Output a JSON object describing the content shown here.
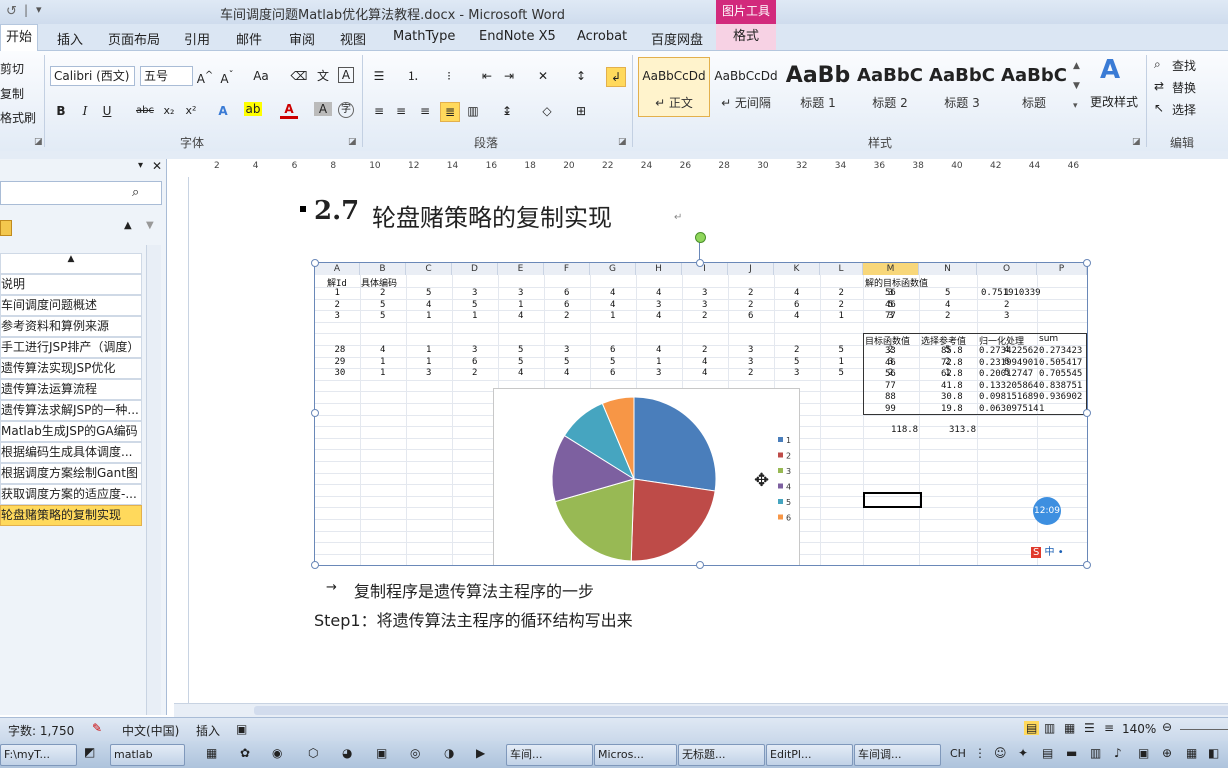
{
  "window": {
    "title": "车间调度问题Matlab优化算法教程.docx - Microsoft Word",
    "context_tools": "图片工具"
  },
  "tabs": [
    "开始",
    "插入",
    "页面布局",
    "引用",
    "邮件",
    "审阅",
    "视图",
    "MathType",
    "EndNote X5",
    "Acrobat",
    "百度网盘"
  ],
  "context_tab": "格式",
  "ribbon": {
    "clipboard": {
      "cut": "剪切",
      "copy": "复制",
      "format_painter": "格式刷"
    },
    "font": {
      "name": "Calibri (西文)",
      "size": "五号",
      "label": "字体"
    },
    "paragraph": {
      "label": "段落"
    },
    "styles": {
      "label": "样式",
      "items": [
        {
          "preview": "AaBbCcDd",
          "name": "↵ 正文"
        },
        {
          "preview": "AaBbCcDd",
          "name": "↵ 无间隔"
        },
        {
          "preview": "AaBb",
          "name": "标题 1"
        },
        {
          "preview": "AaBbC",
          "name": "标题 2"
        },
        {
          "preview": "AaBbC",
          "name": "标题 3"
        },
        {
          "preview": "AaBbC",
          "name": "标题"
        }
      ],
      "change_styles": "更改样式"
    },
    "editing": {
      "label": "编辑",
      "find": "查找",
      "replace": "替换",
      "select": "选择"
    }
  },
  "ruler": {
    "marks": [
      "2",
      "4",
      "6",
      "8",
      "10",
      "12",
      "14",
      "16",
      "18",
      "20",
      "22",
      "24",
      "26",
      "28",
      "30",
      "32",
      "34",
      "36",
      "38",
      "40",
      "42",
      "44",
      "46"
    ]
  },
  "nav": {
    "items": [
      "说明",
      "车间调度问题概述",
      "参考资料和算例来源",
      "手工进行JSP排产（调度）",
      "遗传算法实现JSP优化",
      "遗传算法运算流程",
      "遗传算法求解JSP的一种...",
      "Matlab生成JSP的GA编码",
      "根据编码生成具体调度...",
      "根据调度方案绘制Gant图",
      "获取调度方案的适应度-...",
      "轮盘赌策略的复制实现"
    ],
    "active_index": 11
  },
  "doc": {
    "heading_num": "2.7",
    "heading_text": "轮盘赌策略的复制实现",
    "para1": "复制程序是遗传算法主程序的一步",
    "para2": "Step1：将遗传算法主程序的循环结构写出来"
  },
  "sheet": {
    "columns": [
      "A",
      "B",
      "C",
      "D",
      "E",
      "F",
      "G",
      "H",
      "I",
      "J",
      "K",
      "L",
      "M",
      "N",
      "O",
      "P"
    ],
    "headers": {
      "A": "解Id",
      "B": "具体编码",
      "M": "解的目标函数值"
    },
    "rows": [
      [
        "1",
        "2",
        "5",
        "3",
        "3",
        "6",
        "4",
        "4",
        "3",
        "2",
        "4",
        "2",
        "3",
        "5",
        "1"
      ],
      [
        "2",
        "5",
        "4",
        "5",
        "1",
        "6",
        "4",
        "3",
        "3",
        "2",
        "6",
        "2",
        "5",
        "4",
        "2"
      ],
      [
        "3",
        "5",
        "1",
        "1",
        "4",
        "2",
        "1",
        "4",
        "2",
        "6",
        "4",
        "1",
        "3",
        "2",
        "3"
      ],
      [
        "28",
        "4",
        "1",
        "3",
        "5",
        "3",
        "6",
        "4",
        "2",
        "3",
        "2",
        "5",
        "2",
        "5",
        "4"
      ],
      [
        "29",
        "1",
        "1",
        "6",
        "5",
        "5",
        "5",
        "1",
        "4",
        "3",
        "5",
        "1",
        "3",
        "2",
        "6"
      ],
      [
        "30",
        "1",
        "3",
        "2",
        "4",
        "4",
        "6",
        "3",
        "4",
        "2",
        "3",
        "5",
        "2",
        "1",
        "5"
      ]
    ],
    "m_values": [
      "56",
      "46",
      "77"
    ],
    "o_value": "0.751910339",
    "table_headers": [
      "目标函数值",
      "选择参考值",
      "归一化处理",
      "sum"
    ],
    "table_rows": [
      [
        "33",
        "85.8",
        "0.273422562",
        "0.273423"
      ],
      [
        "46",
        "72.8",
        "0.231994901",
        "0.505417"
      ],
      [
        "56",
        "62.8",
        "0.20012747",
        "0.705545"
      ],
      [
        "77",
        "41.8",
        "0.133205864",
        "0.838751"
      ],
      [
        "88",
        "30.8",
        "0.098151689",
        "0.936902"
      ],
      [
        "99",
        "19.8",
        "0.063097514",
        "1"
      ]
    ],
    "totals": [
      "118.8",
      "313.8"
    ],
    "clock_badge": "12:09"
  },
  "chart_data": {
    "type": "pie",
    "categories": [
      "1",
      "2",
      "3",
      "4",
      "5",
      "6"
    ],
    "values": [
      85.8,
      72.8,
      62.8,
      41.8,
      30.8,
      19.8
    ],
    "colors": [
      "#4a7ebb",
      "#be4b48",
      "#98b954",
      "#7d60a0",
      "#46a5c0",
      "#f79646"
    ],
    "legend": "right"
  },
  "statusbar": {
    "word_count": "字数: 1,750",
    "language": "中文(中国)",
    "mode": "插入",
    "zoom": "140%"
  },
  "taskbar": {
    "items": [
      "F:\\myT...",
      "matlab",
      "车间...",
      "Micros...",
      "无标题...",
      "EditPl...",
      "车间调..."
    ],
    "lang": "CH"
  }
}
